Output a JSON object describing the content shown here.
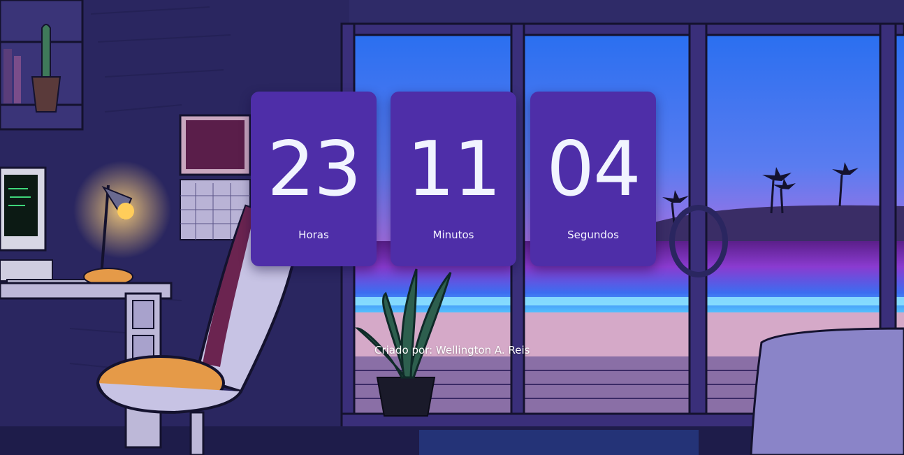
{
  "timer": {
    "hours": "23",
    "minutes": "11",
    "seconds": "04",
    "hours_label": "Horas",
    "minutes_label": "Minutos",
    "seconds_label": "Segundos"
  },
  "footer": {
    "credit": "Criado por: Wellington A. Reis"
  },
  "colors": {
    "card": "#4e2ea8",
    "digits": "#f1f4ff"
  }
}
